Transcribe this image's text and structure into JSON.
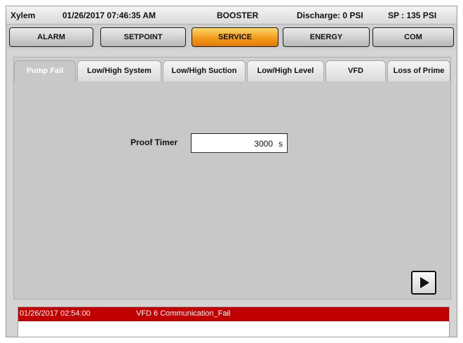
{
  "header": {
    "brand": "Xylem",
    "datetime": "01/26/2017 07:46:35 AM",
    "mode": "BOOSTER",
    "discharge": "Discharge: 0 PSI",
    "setpoint": "SP : 135 PSI"
  },
  "nav": {
    "tabs": [
      {
        "label": "ALARM"
      },
      {
        "label": "SETPOINT"
      },
      {
        "label": "SERVICE",
        "active": true
      },
      {
        "label": "ENERGY"
      },
      {
        "label": "COM"
      }
    ]
  },
  "service": {
    "subtabs": [
      {
        "label": "Pump Fail",
        "active": true
      },
      {
        "label": "Low/High System"
      },
      {
        "label": "Low/High Suction"
      },
      {
        "label": "Low/High Level"
      },
      {
        "label": "VFD"
      },
      {
        "label": "Loss of Prime"
      }
    ],
    "proof_timer": {
      "label": "Proof Timer",
      "value": "3000",
      "unit": "s"
    },
    "next_button_icon": "play-arrow-icon"
  },
  "alarm_log": {
    "entries": [
      {
        "timestamp": "01/26/2017 02:54:00",
        "message": "VFD 6 Communication_Fail"
      }
    ]
  },
  "colors": {
    "active_tab": "#f39a1a",
    "alarm_row": "#c00000",
    "panel_bg": "#c8c8c8"
  }
}
